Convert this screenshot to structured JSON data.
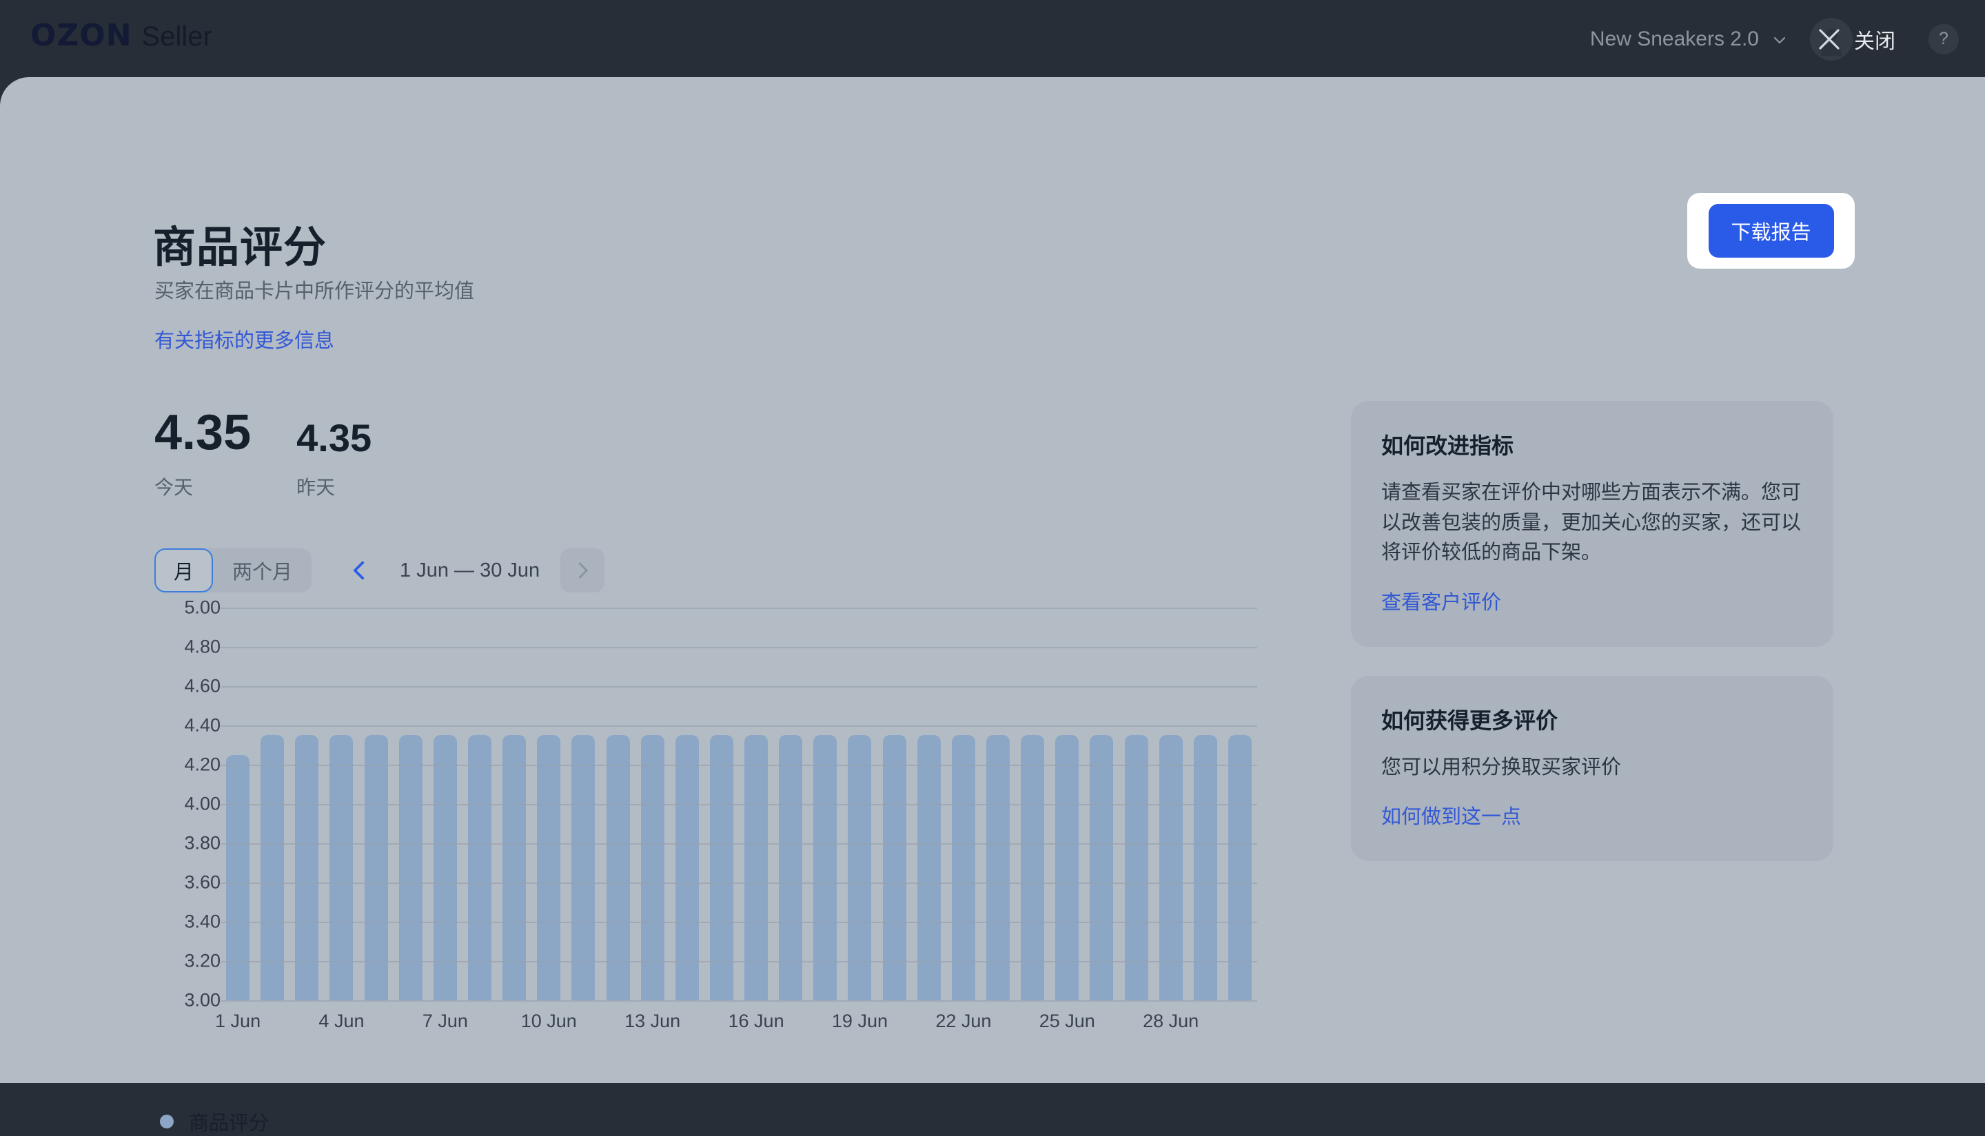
{
  "header": {
    "logo_primary": "OZON",
    "logo_secondary": "Seller",
    "shop_name": "New Sneakers 2.0",
    "close_label": "关闭",
    "help_label": "?"
  },
  "page": {
    "title": "商品评分",
    "subtitle": "买家在商品卡片中所作评分的平均值",
    "more_info_link": "有关指标的更多信息",
    "download_report": "下载报告"
  },
  "kpis": [
    {
      "value": "4.35",
      "label": "今天"
    },
    {
      "value": "4.35",
      "label": "昨天"
    }
  ],
  "controls": {
    "segments": [
      {
        "label": "月",
        "active": true
      },
      {
        "label": "两个月",
        "active": false
      }
    ],
    "range": "1 Jun — 30 Jun"
  },
  "side_cards": [
    {
      "title": "如何改进指标",
      "body": "请查看买家在评价中对哪些方面表示不满。您可以改善包装的质量，更加关心您的买家，还可以将评价较低的商品下架。",
      "link": "查看客户评价"
    },
    {
      "title": "如何获得更多评价",
      "body": "您可以用积分换取买家评价",
      "link": "如何做到这一点"
    }
  ],
  "chart_data": {
    "type": "bar",
    "title": "商品评分",
    "xlabel": "",
    "ylabel": "",
    "ylim": [
      3.0,
      5.0
    ],
    "grid": true,
    "legend_position": "bottom-left",
    "legend": [
      "商品评分"
    ],
    "series_color": "#8CA7C6",
    "yticks": [
      "5.00",
      "4.80",
      "4.60",
      "4.40",
      "4.20",
      "4.00",
      "3.80",
      "3.60",
      "3.40",
      "3.20",
      "3.00"
    ],
    "ytick_values": [
      5.0,
      4.8,
      4.6,
      4.4,
      4.2,
      4.0,
      3.8,
      3.6,
      3.4,
      3.2,
      3.0
    ],
    "xticks": [
      "1 Jun",
      "4 Jun",
      "7 Jun",
      "10 Jun",
      "13 Jun",
      "16 Jun",
      "19 Jun",
      "22 Jun",
      "25 Jun",
      "28 Jun"
    ],
    "xtick_indices": [
      0,
      3,
      6,
      9,
      12,
      15,
      18,
      21,
      24,
      27
    ],
    "categories": [
      "1 Jun",
      "2 Jun",
      "3 Jun",
      "4 Jun",
      "5 Jun",
      "6 Jun",
      "7 Jun",
      "8 Jun",
      "9 Jun",
      "10 Jun",
      "11 Jun",
      "12 Jun",
      "13 Jun",
      "14 Jun",
      "15 Jun",
      "16 Jun",
      "17 Jun",
      "18 Jun",
      "19 Jun",
      "20 Jun",
      "21 Jun",
      "22 Jun",
      "23 Jun",
      "24 Jun",
      "25 Jun",
      "26 Jun",
      "27 Jun",
      "28 Jun",
      "29 Jun",
      "30 Jun"
    ],
    "values": [
      4.25,
      4.35,
      4.35,
      4.35,
      4.35,
      4.35,
      4.35,
      4.35,
      4.35,
      4.35,
      4.35,
      4.35,
      4.35,
      4.35,
      4.35,
      4.35,
      4.35,
      4.35,
      4.35,
      4.35,
      4.35,
      4.35,
      4.35,
      4.35,
      4.35,
      4.35,
      4.35,
      4.35,
      4.35,
      4.35
    ]
  }
}
